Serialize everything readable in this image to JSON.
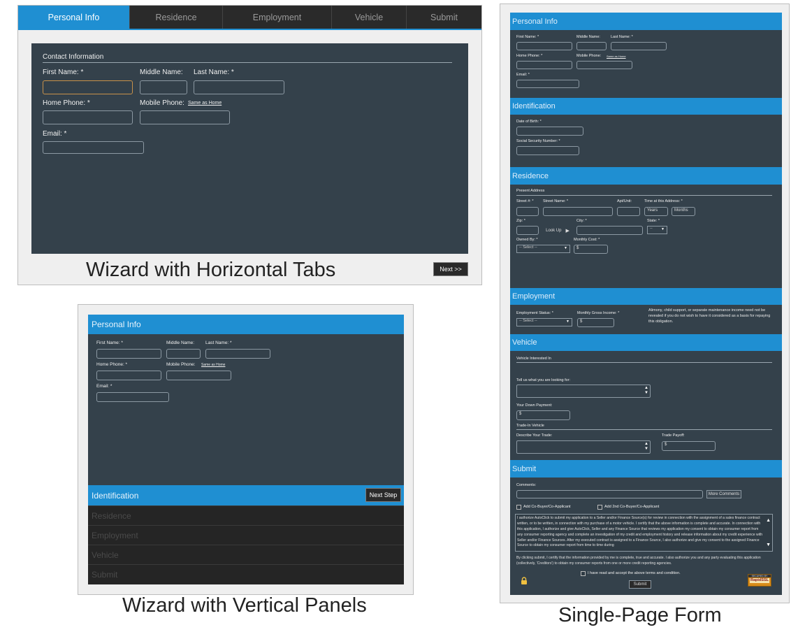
{
  "captions": {
    "horizontal": "Wizard with Horizontal Tabs",
    "vertical": "Wizard with Vertical Panels",
    "single": "Single-Page Form"
  },
  "h_wizard": {
    "tabs": [
      "Personal Info",
      "Residence",
      "Employment",
      "Vehicle",
      "Submit"
    ],
    "section_title": "Contact Information",
    "first_name": "First Name:  *",
    "middle_name": "Middle Name:",
    "last_name": "Last Name:  *",
    "home_phone": "Home Phone:  *",
    "mobile_phone": "Mobile Phone:",
    "same_as_home": "Same as Home",
    "email": "Email:  *",
    "next": "Next >>"
  },
  "v_wizard": {
    "header": "Personal Info",
    "first_name": "First Name:  *",
    "middle_name": "Middle Name:",
    "last_name": "Last Name:  *",
    "home_phone": "Home Phone:  *",
    "mobile_phone": "Mobile Phone:",
    "same_as_home": "Same as Home",
    "email": "Email:  *",
    "active_panel": "Identification",
    "next_step": "Next Step",
    "panels": [
      "Residence",
      "Employment",
      "Vehicle",
      "Submit"
    ]
  },
  "single": {
    "personal": {
      "header": "Personal Info",
      "first_name": "First Name:  *",
      "middle_name": "Middle Name:",
      "last_name": "Last Name:  *",
      "home_phone": "Home Phone:  *",
      "mobile_phone": "Mobile Phone:",
      "same_as_home": "Same as Home",
      "email": "Email:  *"
    },
    "identification": {
      "header": "Identification",
      "dob": "Date of Birth:  *",
      "ssn": "Social Security Number:  *"
    },
    "residence": {
      "header": "Residence",
      "present_address": "Present Address",
      "street_no": "Street #:  *",
      "street_name": "Street Name:  *",
      "apt": "Apt/Unit:",
      "time_at": "Time at this Address:  *",
      "years": "Years",
      "months": "Months",
      "zip": "Zip:  *",
      "look_up": "Look Up",
      "city": "City:  *",
      "state": "State:  *",
      "state_value": "--",
      "owned_by": "Owned By:  *",
      "owned_value": "-- Select --",
      "monthly_cost": "Monthly Cost:  *",
      "dollar": "$"
    },
    "employment": {
      "header": "Employment",
      "status": "Employment Status:  *",
      "status_value": "-- Select --",
      "gross": "Monthly Gross Income:  *",
      "dollar": "$",
      "note": "Alimony, child support, or separate maintenance income need not be revealed if you do not wish to have it considered as a basis for repaying this obligation."
    },
    "vehicle": {
      "header": "Vehicle",
      "interested": "Vehicle Interested In",
      "tell_us": "Tell us what you are looking for:",
      "down_payment": "Your Down Payment:",
      "dollar": "$",
      "trade_in": "Trade-In Vehicle",
      "describe": "Describe Your Trade:",
      "payoff": "Trade Payoff:"
    },
    "submit": {
      "header": "Submit",
      "comments": "Comments:",
      "more_comments": "More Comments",
      "add_co": "Add Co-Buyer/Co-Applicant",
      "add_2nd": "Add 2nd Co-Buyer/Co-Applicant",
      "terms": "I authorize AutoClick to submit my application to a Seller and/or Finance Source(s) for review in connection with the assignment of a sales finance contract written, or to be written, in connection with my purchase of a motor vehicle. I certify that the above information is complete and accurate. In connection with this application, I authorize and give AutoClick, Seller and any Finance Source that reviews my application my consent to obtain my consumer report from any consumer reporting agency and complete an investigation of my credit and employment history and release information about my credit experience with Seller and/or Finance Sources. After my executed contract is assigned to a Finance Source, I also authorize and give my consent to the assigned Finance Source to obtain my consumer report from time to time during",
      "certify": "By clicking submit, I certify that the information provided by me is complete, true and accurate. I also authorize you and any party evaluating this application (collectively, 'Creditors') to obtain my consumer reports from one or more credit reporting agencies.",
      "accept": "I have read and accept the above terms and condition.",
      "submit": "Submit",
      "badge_top": "SECURED BY",
      "badge_brand": "RapidSSL"
    }
  },
  "colors": {
    "accent": "#1f8fd2",
    "panel": "#34414b",
    "dark": "#252525",
    "focus": "#c8924a"
  }
}
